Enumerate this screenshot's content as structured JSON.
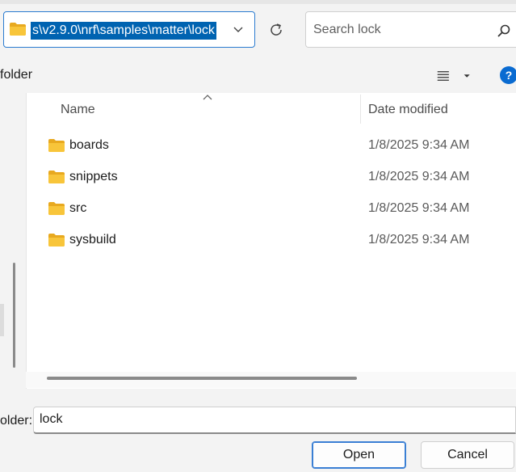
{
  "address_bar": {
    "path": "s\\v2.9.0\\nrf\\samples\\matter\\lock",
    "dropdown_icon": "chevron-down-icon",
    "folder_icon": "folder-icon"
  },
  "refresh": {
    "icon": "refresh-icon"
  },
  "search": {
    "placeholder": "Search lock",
    "icon": "search-icon"
  },
  "toolbar": {
    "label": "folder",
    "view_icon": "view-list-icon",
    "help_label": "?"
  },
  "columns": {
    "name": "Name",
    "date_modified": "Date modified"
  },
  "files": [
    {
      "name": "boards",
      "date": "1/8/2025 9:34 AM",
      "type": "folder"
    },
    {
      "name": "snippets",
      "date": "1/8/2025 9:34 AM",
      "type": "folder"
    },
    {
      "name": "src",
      "date": "1/8/2025 9:34 AM",
      "type": "folder"
    },
    {
      "name": "sysbuild",
      "date": "1/8/2025 9:34 AM",
      "type": "folder"
    }
  ],
  "footer": {
    "folder_label": "older:",
    "folder_value": "lock",
    "open_label": "Open",
    "cancel_label": "Cancel"
  },
  "colors": {
    "accent": "#0063b1",
    "folder_yellow": "#f8c53a",
    "help_blue": "#0a6bd1"
  }
}
